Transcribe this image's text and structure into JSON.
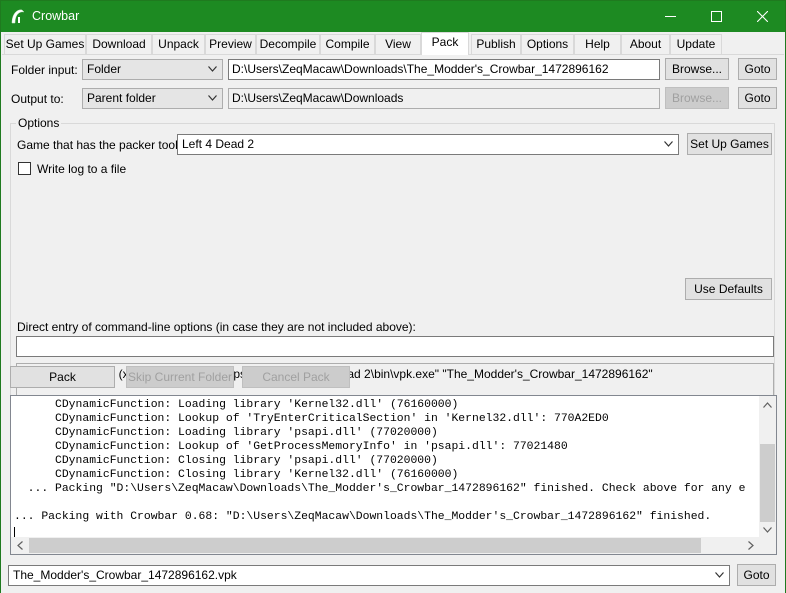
{
  "window": {
    "title": "Crowbar",
    "accent": "#1d8a22"
  },
  "tabs": [
    {
      "label": "Set Up Games"
    },
    {
      "label": "Download"
    },
    {
      "label": "Unpack"
    },
    {
      "label": "Preview"
    },
    {
      "label": "Decompile"
    },
    {
      "label": "Compile"
    },
    {
      "label": "View"
    },
    {
      "label": "Pack"
    },
    {
      "label": "Publish"
    },
    {
      "label": "Options"
    },
    {
      "label": "Help"
    },
    {
      "label": "About"
    },
    {
      "label": "Update"
    }
  ],
  "folder_input": {
    "label": "Folder input:",
    "mode": "Folder",
    "path": "D:\\Users\\ZeqMacaw\\Downloads\\The_Modder's_Crowbar_1472896162",
    "browse": "Browse...",
    "goto": "Goto"
  },
  "output_to": {
    "label": "Output to:",
    "mode": "Parent folder",
    "path": "D:\\Users\\ZeqMacaw\\Downloads",
    "browse": "Browse...",
    "goto": "Goto"
  },
  "options": {
    "legend": "Options",
    "game_label": "Game that has the packer tool:",
    "game_value": "Left 4 Dead 2",
    "setup_games": "Set Up Games",
    "write_log": "Write log to a file",
    "use_defaults": "Use Defaults",
    "direct_entry_label": "Direct entry of command-line options (in case they are not included above):",
    "direct_entry_value": "",
    "command_preview": "\"C:\\Program Files (x86)\\Steam\\steamapps\\common\\Left 4 Dead 2\\bin\\vpk.exe\" \"The_Modder's_Crowbar_1472896162\""
  },
  "actions": {
    "pack": "Pack",
    "skip": "Skip Current Folder",
    "cancel": "Cancel Pack"
  },
  "log": {
    "lines": [
      "      CDynamicFunction: Loading library 'Kernel32.dll' (76160000)",
      "      CDynamicFunction: Lookup of 'TryEnterCriticalSection' in 'Kernel32.dll': 770A2ED0",
      "      CDynamicFunction: Loading library 'psapi.dll' (77020000)",
      "      CDynamicFunction: Lookup of 'GetProcessMemoryInfo' in 'psapi.dll': 77021480",
      "      CDynamicFunction: Closing library 'psapi.dll' (77020000)",
      "      CDynamicFunction: Closing library 'Kernel32.dll' (76160000)",
      "  ... Packing \"D:\\Users\\ZeqMacaw\\Downloads\\The_Modder's_Crowbar_1472896162\" finished. Check above for any e",
      "",
      "... Packing with Crowbar 0.68: \"D:\\Users\\ZeqMacaw\\Downloads\\The_Modder's_Crowbar_1472896162\" finished."
    ]
  },
  "output_file": {
    "value": "The_Modder's_Crowbar_1472896162.vpk",
    "goto": "Goto"
  }
}
